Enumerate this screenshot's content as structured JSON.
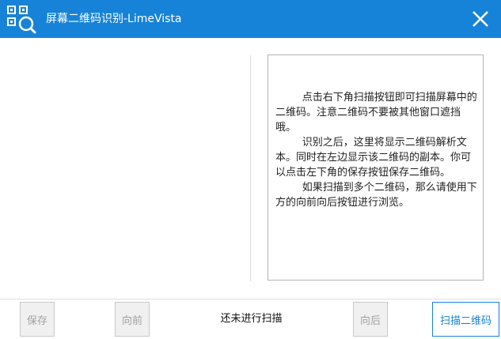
{
  "window": {
    "title": "屏幕二维码识别-LimeVista",
    "app_icon": "qr-search-icon",
    "close_icon": "close-icon",
    "accent_color": "#1683d8"
  },
  "info": {
    "paragraphs": [
      "点击右下角扫描按钮即可扫描屏幕中的二维码。注意二维码不要被其他窗口遮挡哦。",
      "识别之后，这里将显示二维码解析文本。同时在左边显示该二维码的副本。你可以点击左下角的保存按钮保存二维码。",
      "如果扫描到多个二维码，那么请使用下方的向前向后按钮进行浏览。"
    ]
  },
  "footer": {
    "save_label": "保存",
    "prev_label": "向前",
    "status_text": "还未进行扫描",
    "next_label": "向后",
    "scan_label": "扫描二维码"
  }
}
